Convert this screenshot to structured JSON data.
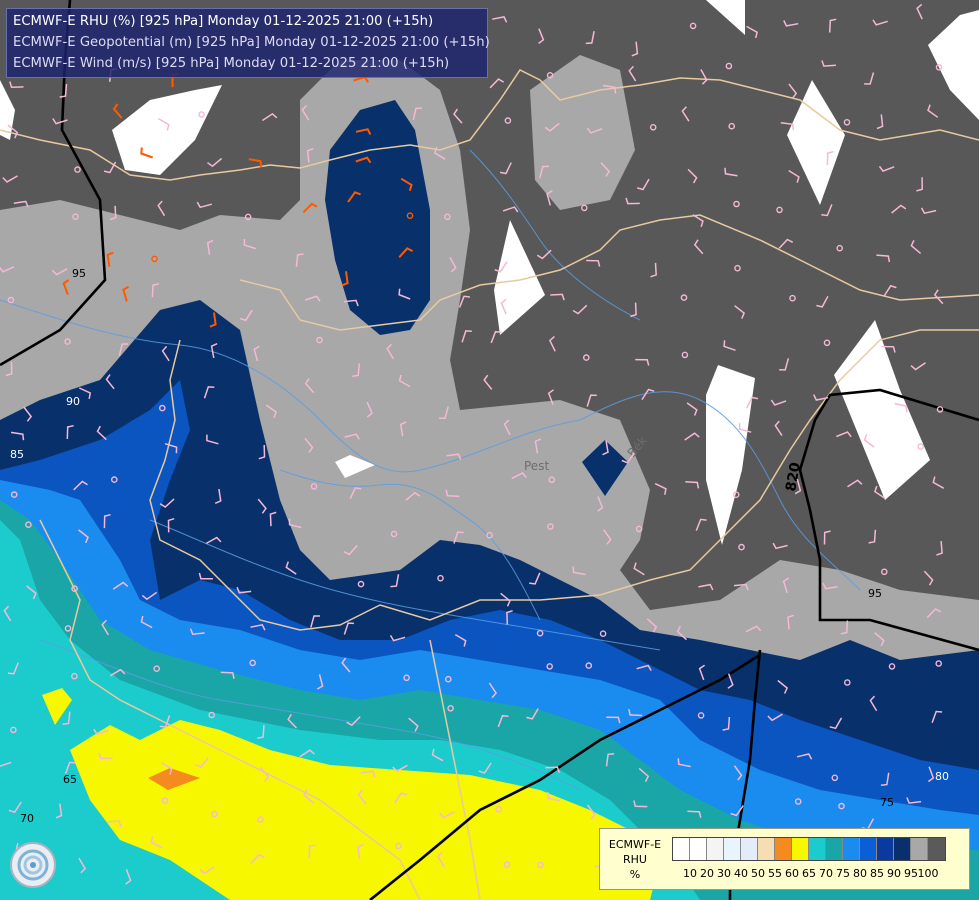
{
  "header": {
    "line1": "ECMWF-E RHU (%) [925 hPa] Monday 01-12-2025 21:00 (+15h)",
    "line2": "ECMWF-E Geopotential (m) [925 hPa] Monday 01-12-2025 21:00 (+15h)",
    "line3": "ECMWF-E Wind (m/s) [925 hPa] Monday 01-12-2025 21:00 (+15h)"
  },
  "legend": {
    "title_l1": "ECMWF-E",
    "title_l2": "RHU",
    "title_l3": "%",
    "ticks": [
      "10",
      "20",
      "30",
      "40",
      "50",
      "55",
      "60",
      "65",
      "70",
      "75",
      "80",
      "85",
      "90",
      "95",
      "100"
    ],
    "colors": [
      "#ffffff",
      "#ffffff",
      "#f4f4f4",
      "#e8f4ff",
      "#e4ecfa",
      "#f5deb3",
      "#f58a1e",
      "#f7f700",
      "#1ccccc",
      "#1aa6a6",
      "#1a8cf0",
      "#0a5ed6",
      "#0a3aa0",
      "#08306a",
      "#a8a8a8",
      "#5a5a5a"
    ]
  },
  "map_labels": {
    "city_pest": "Pest",
    "city_bekes": "Bék",
    "geo_820": "820",
    "contour_95_a": "95",
    "contour_90": "90",
    "contour_85": "85",
    "contour_95_b": "95",
    "contour_80": "80",
    "contour_75": "75",
    "contour_65": "65",
    "contour_70": "70"
  },
  "colors": {
    "rhu_100": "#585858",
    "rhu_95": "#a8a8a8",
    "rhu_90": "#08306a",
    "rhu_85": "#0a55c0",
    "rhu_80": "#1a8cf0",
    "rhu_75": "#1aa6a6",
    "rhu_70": "#1ccccc",
    "rhu_65": "#f7f700",
    "rhu_60": "#f58a1e",
    "rhu_dry": "#ffffff",
    "border": "#e8c9a0",
    "river": "#5a9ee0",
    "geopotential": "#000000",
    "wind_barb": "#f5b8d6",
    "wind_barb_strong": "#ff5a00"
  },
  "icons": {
    "logo": "ecmwf-swirl-icon"
  }
}
